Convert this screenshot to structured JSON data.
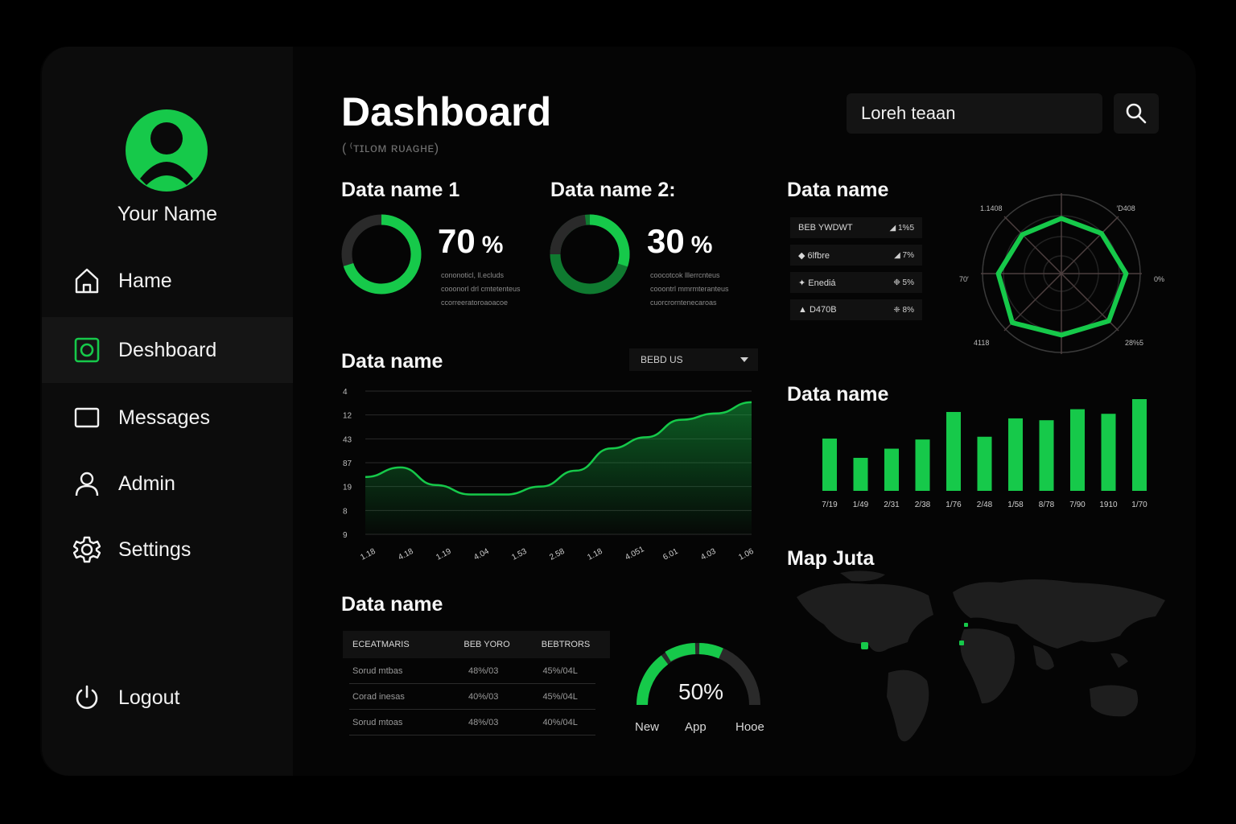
{
  "user": {
    "name": "Your Name"
  },
  "nav": [
    {
      "label": "Hame",
      "icon": "home-icon"
    },
    {
      "label": "Deshboard",
      "icon": "dashboard-icon",
      "active": true
    },
    {
      "label": "Messages",
      "icon": "messages-icon"
    },
    {
      "label": "Admin",
      "icon": "user-icon"
    },
    {
      "label": "Settings",
      "icon": "gear-icon"
    }
  ],
  "logout": {
    "label": "Logout",
    "icon": "power-icon"
  },
  "header": {
    "title": "Dashboard",
    "subtitle": "( ⁽ᴛɪʟᴏᴍ ʀᴜᴀɢʜᴇ)"
  },
  "search": {
    "value": "Loreh teaan",
    "icon": "search-icon"
  },
  "colors": {
    "accent": "#16c94a",
    "accent_dark": "#0f7a30",
    "track": "#2a2a2a",
    "bg": "#050505"
  },
  "donut1": {
    "title": "Data name 1",
    "value": 70,
    "value_text": "70",
    "unit": "%",
    "lines": [
      "cononoticl, ll.ecluds",
      "cooonorl drl cmtetenteus",
      "ccorreeratoroaoacoe"
    ]
  },
  "donut2": {
    "title": "Data name 2:",
    "value": 30,
    "value_text": "30",
    "unit": "%",
    "lines": [
      "coocotcok lllerrcnteus",
      "cooontrl mmrmteranteus",
      "cuorcrorntenecaroas"
    ]
  },
  "radar_panel": {
    "title": "Data name",
    "legend": [
      {
        "label": "BEB YWDWT",
        "value": "◢ 1%5"
      },
      {
        "label": "◆ 6lfbre",
        "value": "◢ 7%"
      },
      {
        "label": "✦ Enediá",
        "value": "❉ 5%"
      },
      {
        "label": "▲ D470B",
        "value": "❈ 8%"
      }
    ],
    "chart_data": {
      "type": "radar",
      "axis_labels": [
        "1.1408",
        " ′D408",
        "0%",
        "28%5",
        "4118",
        "70′"
      ],
      "values": [
        0.7,
        0.72,
        0.82,
        0.85,
        0.78,
        0.88,
        0.8,
        0.7
      ],
      "range": [
        0,
        1
      ]
    }
  },
  "line_panel": {
    "title": "Data name",
    "select_value": "BEBD US",
    "chart_data": {
      "type": "area",
      "y_ticks": [
        "4",
        "12",
        "43",
        "87",
        "19",
        "8",
        "9"
      ],
      "x_ticks": [
        "1.18",
        "4.18",
        "1.19",
        "4.04",
        "1.53",
        "2.58",
        "1.18",
        "4.051",
        "6.01",
        "4.03",
        "1.06"
      ],
      "values": [
        3.6,
        4.2,
        3.1,
        2.5,
        2.5,
        3.0,
        4.0,
        5.4,
        6.1,
        7.2,
        7.6,
        8.3
      ]
    }
  },
  "bar_panel": {
    "title": "Data name",
    "chart_data": {
      "type": "bar",
      "categories": [
        "7/19",
        "1/49",
        "2/31",
        "2/38",
        "1/76",
        "2/48",
        "1/58",
        "8/78",
        "7/90",
        "1910",
        "1/70"
      ],
      "values": [
        57,
        36,
        46,
        56,
        86,
        59,
        79,
        77,
        89,
        84,
        100
      ]
    }
  },
  "table_panel": {
    "title": "Data name",
    "headers": [
      "ECEATMARIS",
      "BEB YORO",
      "BEBTRORS"
    ],
    "rows": [
      [
        "Sorud mtbas",
        "48%/03",
        "45%/04L"
      ],
      [
        "Corad inesas",
        "40%/03",
        "45%/04L"
      ],
      [
        "Sorud mtoas",
        "48%/03",
        "40%/04L"
      ]
    ]
  },
  "gauge": {
    "value": 50,
    "value_text": "50%",
    "labels": [
      "New",
      "App",
      "Hooe"
    ]
  },
  "map_panel": {
    "title": "Map Juta"
  }
}
